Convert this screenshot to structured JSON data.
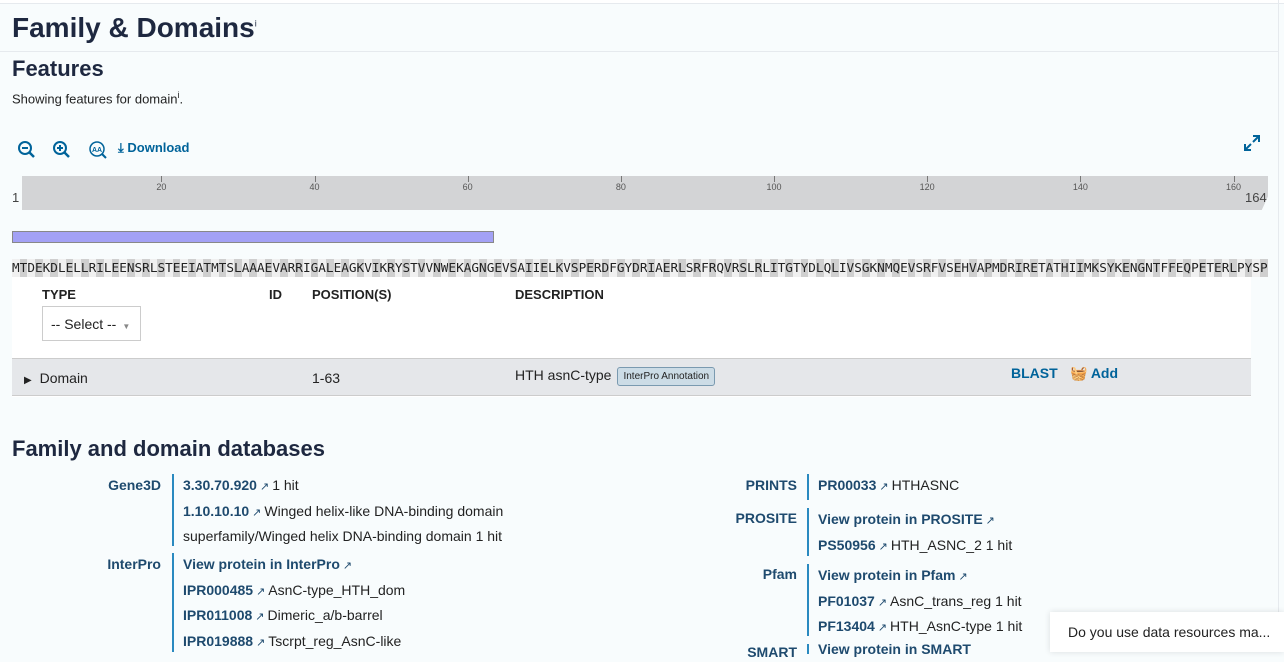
{
  "title": "Family & Domains",
  "info_mark": "i",
  "features": {
    "heading": "Features",
    "subtitle": "Showing features for domain",
    "download": "Download"
  },
  "viewer": {
    "start": "1",
    "end": "164",
    "ticks": [
      20,
      40,
      60,
      80,
      100,
      120,
      140,
      160
    ],
    "length": 164,
    "domain": {
      "start": 1,
      "end": 63,
      "color": "#a3a1f5"
    },
    "sequence": "MTDEKDLELLRILEENSRLSTEEIATMTSLAAAEVARRIGALEAGKVIKRYSTVVNWEKAGNGEVSAIIELKVSPERDFGYDRIAERLSRFRQVRSLRLITGTYDLQLIVSGKNMQEVSRFVSEHVAPMDRIRETATHIIMKSYKENGNTFFEQPETERLPYSP"
  },
  "table": {
    "headers": {
      "type": "TYPE",
      "id": "ID",
      "position": "POSITION(S)",
      "description": "DESCRIPTION"
    },
    "select": "-- Select --",
    "row": {
      "type": "Domain",
      "id": "",
      "position": "1-63",
      "description": "HTH asnC-type",
      "badge": "InterPro Annotation",
      "blast": "BLAST",
      "add": "Add"
    }
  },
  "databases": {
    "heading": "Family and domain databases",
    "gene3d": {
      "label": "Gene3D",
      "l1": "3.30.70.920",
      "t1": "1 hit",
      "l2": "1.10.10.10",
      "t2": "Winged helix-like DNA-binding domain",
      "t3": "superfamily/Winged helix DNA-binding domain 1 hit"
    },
    "interpro": {
      "label": "InterPro",
      "view": "View protein in InterPro",
      "items": [
        {
          "id": "IPR000485",
          "desc": "AsnC-type_HTH_dom"
        },
        {
          "id": "IPR011008",
          "desc": "Dimeric_a/b-barrel"
        },
        {
          "id": "IPR019888",
          "desc": "Tscrpt_reg_AsnC-like"
        }
      ]
    },
    "prints": {
      "label": "PRINTS",
      "id": "PR00033",
      "desc": "HTHASNC"
    },
    "prosite": {
      "label": "PROSITE",
      "view": "View protein in PROSITE",
      "id": "PS50956",
      "desc": "HTH_ASNC_2 1 hit"
    },
    "pfam": {
      "label": "Pfam",
      "view": "View protein in Pfam",
      "items": [
        {
          "id": "PF01037",
          "desc": "AsnC_trans_reg 1 hit"
        },
        {
          "id": "PF13404",
          "desc": "HTH_AsnC-type 1 hit"
        }
      ]
    },
    "smart": {
      "label": "SMART",
      "view": "View protein in SMART"
    }
  },
  "popup": "Do you use data resources ma..."
}
